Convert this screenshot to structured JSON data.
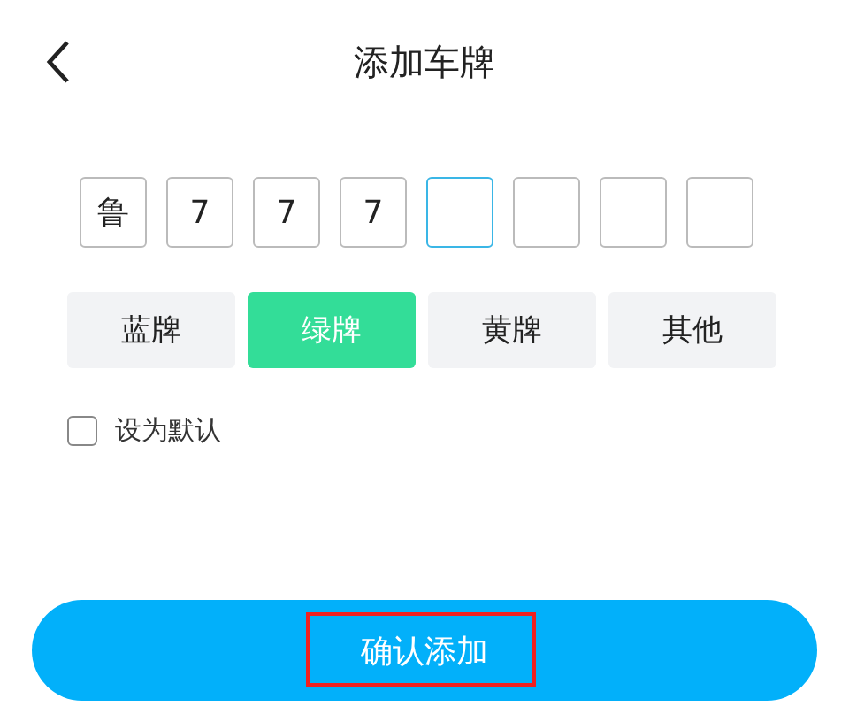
{
  "header": {
    "title": "添加车牌"
  },
  "plate_cells": [
    {
      "value": "鲁",
      "selected": false
    },
    {
      "value": "7",
      "selected": false
    },
    {
      "value": "7",
      "selected": false
    },
    {
      "value": "7",
      "selected": false
    },
    {
      "selected": true
    },
    {
      "selected": false
    },
    {
      "selected": false
    },
    {
      "selected": false
    }
  ],
  "plate_types": [
    {
      "label": "蓝牌",
      "selected": false
    },
    {
      "label": "绿牌",
      "selected": true
    },
    {
      "label": "黄牌",
      "selected": false
    },
    {
      "label": "其他",
      "selected": false
    }
  ],
  "default_option": {
    "label": "设为默认",
    "checked": false
  },
  "confirm_button": {
    "label": "确认添加",
    "highlighted": true
  }
}
